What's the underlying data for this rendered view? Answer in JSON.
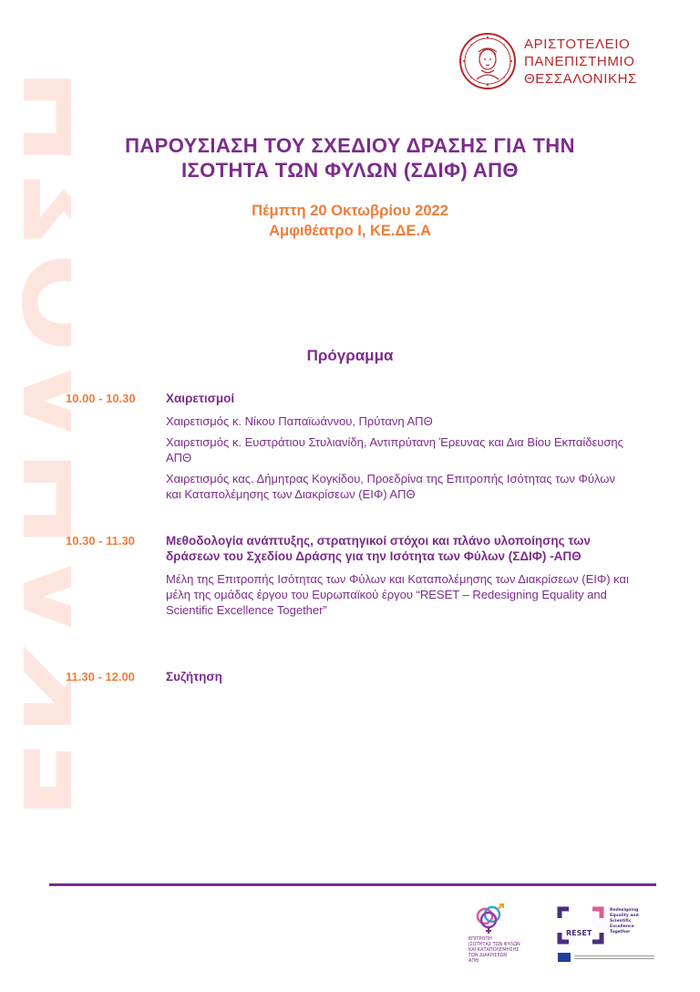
{
  "background_word": "ΕΚΔΗΛΩΣΗ",
  "university": {
    "name_lines": [
      "ΑΡΙΣΤΟΤΕΛΕΙΟ",
      "ΠΑΝΕΠΙΣΤΗΜΙΟ",
      "ΘΕΣΣΑΛΟΝΙΚΗΣ"
    ]
  },
  "title_lines": [
    "ΠΑΡΟΥΣΙΑΣΗ ΤΟΥ ΣΧΕΔΙΟΥ ΔΡΑΣΗΣ ΓΙΑ ΤΗΝ",
    "ΙΣΟΤΗΤΑ ΤΩΝ ΦΥΛΩΝ (ΣΔΙΦ) ΑΠΘ"
  ],
  "event": {
    "date": "Πέμπτη 20 Οκτωβρίου 2022",
    "venue": "Αμφιθέατρο Ι, ΚΕ.ΔΕ.Α"
  },
  "program": {
    "heading": "Πρόγραμμα",
    "sessions": [
      {
        "time": "10.00 - 10.30",
        "title": "Χαιρετισμοί",
        "items": [
          "Χαιρετισμός κ. Νίκου Παπαϊωάννου, Πρύτανη ΑΠΘ",
          "Χαιρετισμός κ. Ευστράτιου Στυλιανίδη, Αντιπρύτανη Έρευνας και Δια Βίου Εκπαίδευσης ΑΠΘ",
          "Χαιρετισμός κας. Δήμητρας Κογκίδου, Προεδρίνα της Επιτροπής Ισότητας των Φύλων και Καταπολέμησης των Διακρίσεων (ΕΙΦ) ΑΠΘ"
        ]
      },
      {
        "time": "10.30 - 11.30",
        "title": "Μεθοδολογία ανάπτυξης, στρατηγικοί στόχοι και πλάνο υλοποίησης των δράσεων του Σχεδίου Δράσης για την Ισότητα των Φύλων (ΣΔΙΦ) -ΑΠΘ",
        "items": [
          "Μέλη της Επιτροπής Ισότητας των Φύλων και Καταπολέμησης των Διακρίσεων (ΕΙΦ) και μέλη της ομάδας έργου του Ευρωπαϊκού έργου “RESET – Redesigning Equality and Scientific Excellence Together”"
        ]
      },
      {
        "time": "11.30 - 12.00",
        "title": "Συζήτηση",
        "items": []
      }
    ]
  },
  "footer": {
    "committee_logo_lines": [
      "ΕΠΙΤΡΟΠΗ",
      "ΙΣΟΤΗΤΑΣ ΤΩΝ ΦΥΛΩΝ",
      "ΚΑΙ ΚΑΤΑΠΟΛΕΜΗΣΗΣ",
      "ΤΩΝ ΔΙΑΚΡΙΣΕΩΝ",
      "ΑΠΘ"
    ],
    "reset_logo": {
      "word": "RESET",
      "tagline_lines": [
        "Redesigning",
        "Equality and",
        "Scientific",
        "Excellence",
        "Together"
      ]
    },
    "colors": {
      "purple": "#7b2c8b",
      "orange": "#ef7d3a",
      "university_red": "#b8262b"
    }
  }
}
